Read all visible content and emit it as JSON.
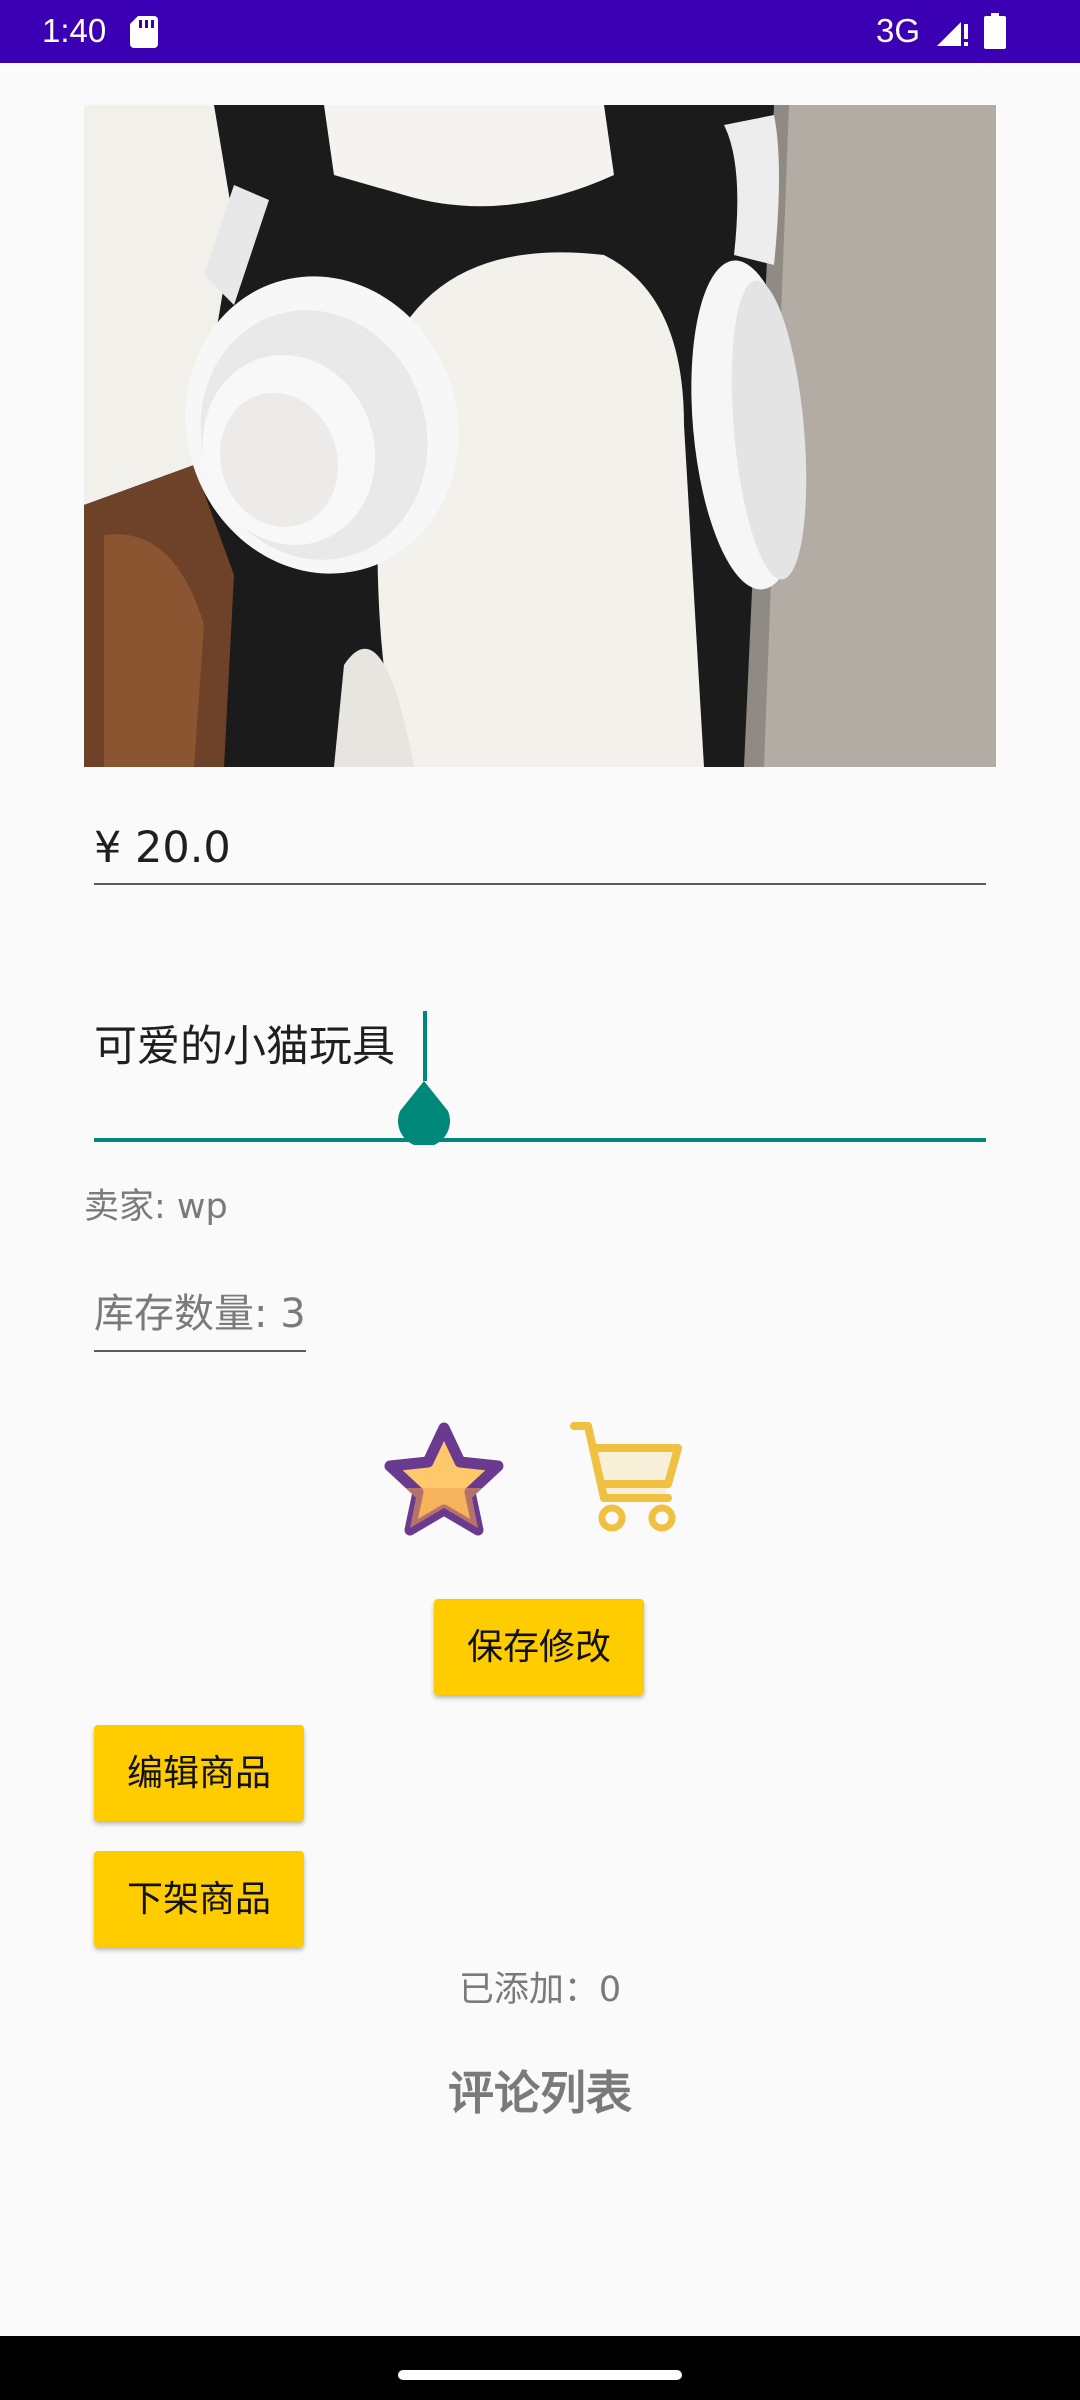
{
  "status_bar": {
    "time": "1:40",
    "network": "3G",
    "background_color": "#3c00b4",
    "icons": [
      "sd-card-icon",
      "signal-icon",
      "battery-icon"
    ]
  },
  "product": {
    "image_alt": "白色耳机与毛绒玩具照片",
    "price": "¥ 20.0",
    "name": "可爱的小猫玩具",
    "seller": "卖家: wp",
    "stock": "库存数量: 3"
  },
  "actions": {
    "favorite_icon": "star-icon",
    "cart_icon": "shopping-cart-icon",
    "save_label": "保存修改",
    "edit_label": "编辑商品",
    "delist_label": "下架商品"
  },
  "added_text": "已添加：0",
  "comments_title": "评论列表",
  "colors": {
    "accent": "#00897b",
    "button": "#ffcc00",
    "star_fill": "#ffc86b",
    "star_outline": "#6a3a8e",
    "cart": "#f0c040"
  }
}
